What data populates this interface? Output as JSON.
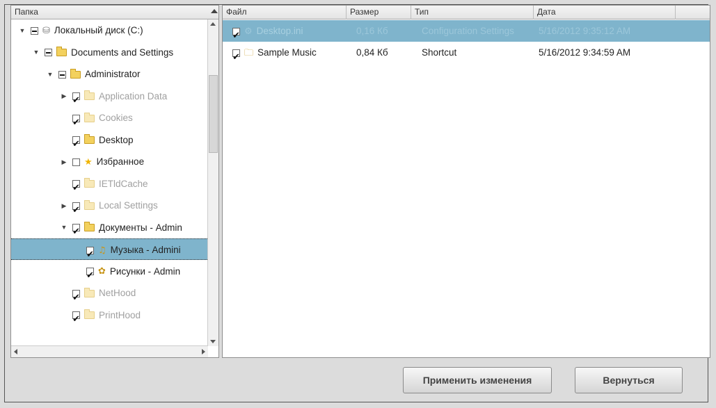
{
  "tree": {
    "header": "Папка",
    "items": [
      {
        "label": "Локальный диск (C:)",
        "depth": 0,
        "twisty": "open",
        "check": "partial",
        "icon": "drive-icon",
        "dim": false,
        "selected": false
      },
      {
        "label": "Documents and Settings",
        "depth": 1,
        "twisty": "open",
        "check": "partial",
        "icon": "folder-icon",
        "dim": false,
        "selected": false
      },
      {
        "label": "Administrator",
        "depth": 2,
        "twisty": "open",
        "check": "partial",
        "icon": "folder-icon",
        "dim": false,
        "selected": false
      },
      {
        "label": "Application Data",
        "depth": 3,
        "twisty": "closed",
        "check": "checked",
        "icon": "folder-icon",
        "dim": true,
        "selected": false
      },
      {
        "label": "Cookies",
        "depth": 3,
        "twisty": "none",
        "check": "checked",
        "icon": "folder-icon",
        "dim": true,
        "selected": false
      },
      {
        "label": "Desktop",
        "depth": 3,
        "twisty": "none",
        "check": "checked",
        "icon": "folder-icon",
        "dim": false,
        "selected": false
      },
      {
        "label": "Избранное",
        "depth": 3,
        "twisty": "closed",
        "check": "unchecked",
        "icon": "star-folder-icon",
        "dim": false,
        "selected": false
      },
      {
        "label": "IETldCache",
        "depth": 3,
        "twisty": "none",
        "check": "checked",
        "icon": "folder-icon",
        "dim": true,
        "selected": false
      },
      {
        "label": "Local Settings",
        "depth": 3,
        "twisty": "closed",
        "check": "checked",
        "icon": "folder-icon",
        "dim": true,
        "selected": false
      },
      {
        "label": "Документы - Admin",
        "depth": 3,
        "twisty": "open",
        "check": "checked",
        "icon": "folder-icon",
        "dim": false,
        "selected": false
      },
      {
        "label": "Музыка - Admini",
        "depth": 4,
        "twisty": "none",
        "check": "checked",
        "icon": "music-folder-icon",
        "dim": false,
        "selected": true
      },
      {
        "label": "Рисунки - Admin",
        "depth": 4,
        "twisty": "none",
        "check": "checked",
        "icon": "pictures-folder-icon",
        "dim": false,
        "selected": false
      },
      {
        "label": "NetHood",
        "depth": 3,
        "twisty": "none",
        "check": "checked",
        "icon": "folder-icon",
        "dim": true,
        "selected": false
      },
      {
        "label": "PrintHood",
        "depth": 3,
        "twisty": "none",
        "check": "checked",
        "icon": "folder-icon",
        "dim": true,
        "selected": false
      }
    ]
  },
  "files": {
    "headers": {
      "name": "Файл",
      "size": "Размер",
      "type": "Тип",
      "date": "Дата"
    },
    "rows": [
      {
        "name": "Desktop.ini",
        "size": "0,16 Кб",
        "type": "Configuration Settings",
        "date": "5/16/2012 9:35:12 AM",
        "selected": true,
        "icon": "settings-file-icon"
      },
      {
        "name": "Sample Music",
        "size": "0,84 Кб",
        "type": "Shortcut",
        "date": "5/16/2012 9:34:59 AM",
        "selected": false,
        "icon": "shortcut-icon"
      }
    ]
  },
  "buttons": {
    "apply": "Применить изменения",
    "back": "Вернуться"
  }
}
